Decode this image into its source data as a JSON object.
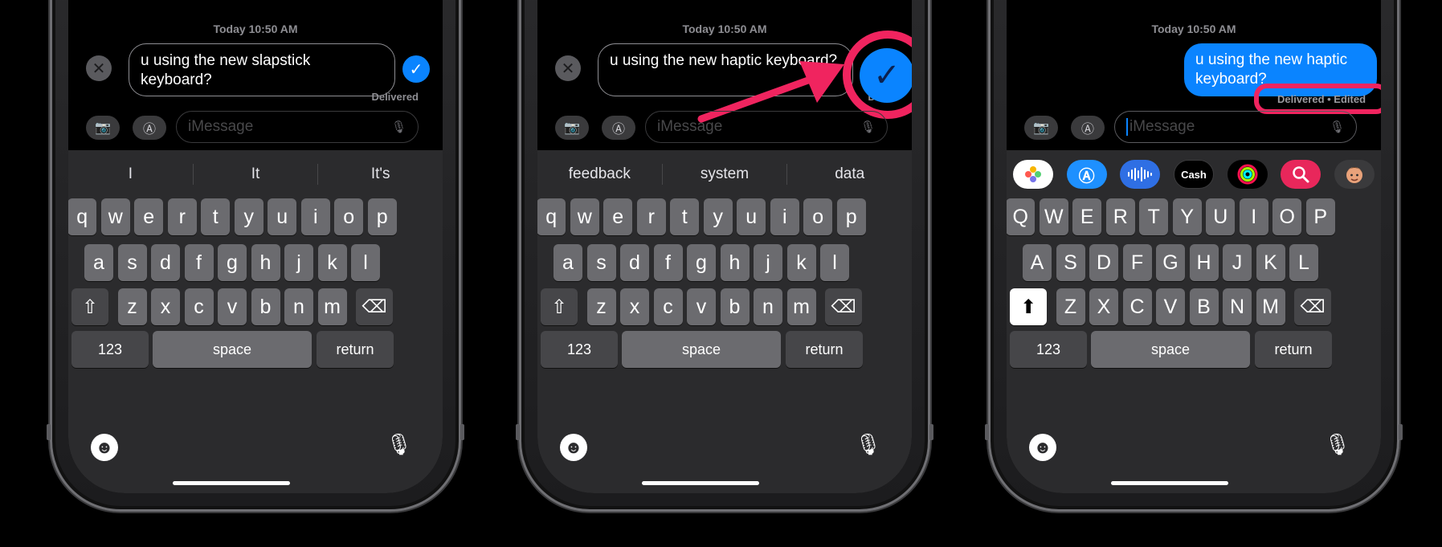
{
  "timestamp": "Today 10:50 AM",
  "panels": [
    {
      "edit_text": "u using the new slapstick keyboard?",
      "delivered": "Delivered",
      "suggestions": [
        "I",
        "It",
        "It's"
      ]
    },
    {
      "edit_text": "u using the new haptic keyboard?",
      "delivered": "De",
      "suggestions": [
        "feedback",
        "system",
        "data"
      ]
    },
    {
      "sent_text": "u using the new haptic keyboard?",
      "status": "Delivered • Edited",
      "apps": [
        "photos-icon",
        "app-store-icon",
        "audio-icon",
        "Cash",
        "activity-icon",
        "search-web-icon",
        "memoji-icon"
      ]
    }
  ],
  "input_placeholder": "iMessage",
  "keys_lower": [
    [
      "q",
      "w",
      "e",
      "r",
      "t",
      "y",
      "u",
      "i",
      "o",
      "p"
    ],
    [
      "a",
      "s",
      "d",
      "f",
      "g",
      "h",
      "j",
      "k",
      "l"
    ],
    [
      "z",
      "x",
      "c",
      "v",
      "b",
      "n",
      "m"
    ]
  ],
  "keys_upper": [
    [
      "Q",
      "W",
      "E",
      "R",
      "T",
      "Y",
      "U",
      "I",
      "O",
      "P"
    ],
    [
      "A",
      "S",
      "D",
      "F",
      "G",
      "H",
      "J",
      "K",
      "L"
    ],
    [
      "Z",
      "X",
      "C",
      "V",
      "B",
      "N",
      "M"
    ]
  ],
  "numbers_label": "123",
  "space_label": "space",
  "return_label": "return",
  "icons": {
    "cancel": "✕",
    "confirm": "✓",
    "shift": "⇧",
    "shift_filled": "⬆",
    "delete": "⌫",
    "emoji": "☻",
    "mic": "🎙",
    "camera": "📷",
    "apps": "Ⓐ"
  },
  "colors": {
    "accent_blue": "#0a84ff",
    "highlight_pink": "#f0245f"
  }
}
